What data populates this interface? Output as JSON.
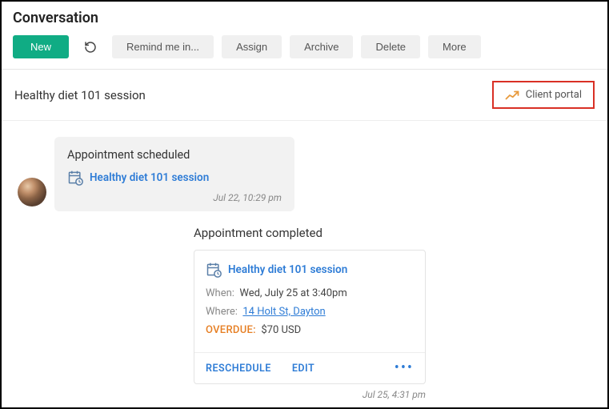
{
  "header": {
    "title": "Conversation",
    "buttons": {
      "new": "New",
      "remind": "Remind me in...",
      "assign": "Assign",
      "archive": "Archive",
      "delete": "Delete",
      "more": "More"
    }
  },
  "subheader": {
    "subject": "Healthy diet 101 session",
    "client_portal": "Client portal"
  },
  "msg1": {
    "title": "Appointment scheduled",
    "link": "Healthy diet 101 session",
    "timestamp": "Jul 22, 10:29 pm"
  },
  "msg2": {
    "title": "Appointment completed",
    "link": "Healthy diet 101 session",
    "when_label": "When:",
    "when_value": "Wed, July 25 at 3:40pm",
    "where_label": "Where:",
    "where_value": "14 Holt St, Dayton",
    "overdue_label": "OVERDUE:",
    "overdue_value": "$70 USD",
    "reschedule": "RESCHEDULE",
    "edit": "EDIT",
    "timestamp": "Jul 25, 4:31 pm"
  }
}
